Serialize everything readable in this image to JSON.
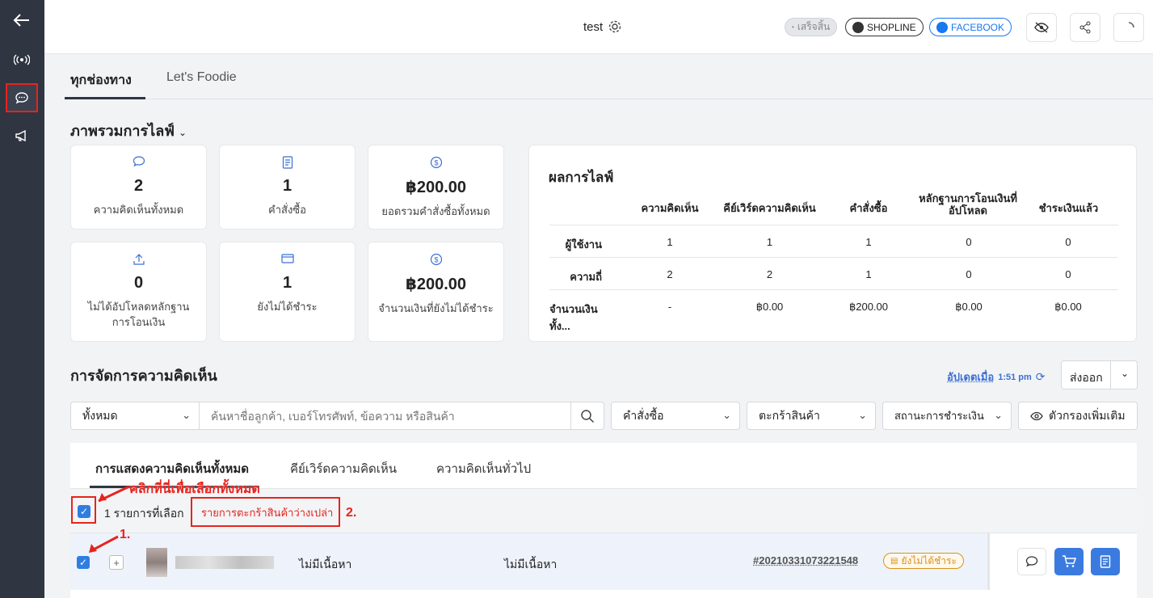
{
  "topbar": {
    "title": "test",
    "ended_label": "เสร็จสิ้น",
    "shopline_label": "SHOPLINE",
    "facebook_label": "FACEBOOK"
  },
  "tabs": [
    {
      "label": "ทุกช่องทาง"
    },
    {
      "label": "Let's Foodie"
    }
  ],
  "overview": {
    "title": "ภาพรวมการไลฟ์",
    "cards": [
      {
        "value": "2",
        "label": "ความคิดเห็นทั้งหมด",
        "icon": "comment-icon"
      },
      {
        "value": "1",
        "label": "คำสั่งซื้อ",
        "icon": "order-icon"
      },
      {
        "value": "฿200.00",
        "label": "ยอดรวมคำสั่งซื้อทั้งหมด",
        "icon": "coin-icon"
      },
      {
        "value": "0",
        "label": "ไม่ได้อัปโหลดหลักฐาน การโอนเงิน",
        "icon": "upload-icon"
      },
      {
        "value": "1",
        "label": "ยังไม่ได้ชำระ",
        "icon": "card-icon"
      },
      {
        "value": "฿200.00",
        "label": "จำนวนเงินที่ยังไม่ได้ชำระ",
        "icon": "coin-icon"
      }
    ]
  },
  "results": {
    "title": "ผลการไลฟ์",
    "headers": [
      "ความคิดเห็น",
      "คีย์เวิร์ดความคิดเห็น",
      "คำสั่งซื้อ",
      "หลักฐานการโอนเงินที่อัปโหลด",
      "ชำระเงินแล้ว"
    ],
    "rows": [
      {
        "label": "ผู้ใช้งาน",
        "cells": [
          "1",
          "1",
          "1",
          "0",
          "0"
        ]
      },
      {
        "label": "ความถี่",
        "cells": [
          "2",
          "2",
          "1",
          "0",
          "0"
        ]
      },
      {
        "label": "จำนวนเงินทั้ง...",
        "cells": [
          "-",
          "฿0.00",
          "฿200.00",
          "฿0.00",
          "฿0.00"
        ]
      }
    ]
  },
  "comments": {
    "title": "การจัดการความคิดเห็น",
    "updated_label": "อัปเดตเมื่อ",
    "updated_time": "1:51 pm",
    "export_label": "ส่งออก",
    "scope_value": "ทั้งหมด",
    "search_placeholder": "ค้นหาชื่อลูกค้า, เบอร์โทรศัพท์, ข้อความ หรือสินค้า",
    "filter_order": "คำสั่งซื้อ",
    "filter_cart": "ตะกร้าสินค้า",
    "filter_payment": "สถานะการชำระเงิน",
    "more_filters": "ตัวกรองเพิ่มเติม",
    "tabs": [
      "การแสดงความคิดเห็นทั้งหมด",
      "คีย์เวิร์ดความคิดเห็น",
      "ความคิดเห็นทั่วไป"
    ],
    "selected_count": "1 รายการที่เลือก",
    "empty_cart_action": "รายการตะกร้าสินค้าว่างเปล่า",
    "row": {
      "col1": "ไม่มีเนื้อหา",
      "col2": "ไม่มีเนื้อหา",
      "order_id": "#20210331073221548",
      "status": "ยังไม่ได้ชำระ"
    }
  },
  "annotations": {
    "select_all": "คลิกที่นี่เพื่อเลือกทั้งหมด",
    "step1": "1.",
    "step2": "2."
  },
  "colors": {
    "accent": "#3b7be0",
    "annotation": "#e8231e",
    "sidebar": "#2f3541",
    "warning": "#d9921a"
  }
}
